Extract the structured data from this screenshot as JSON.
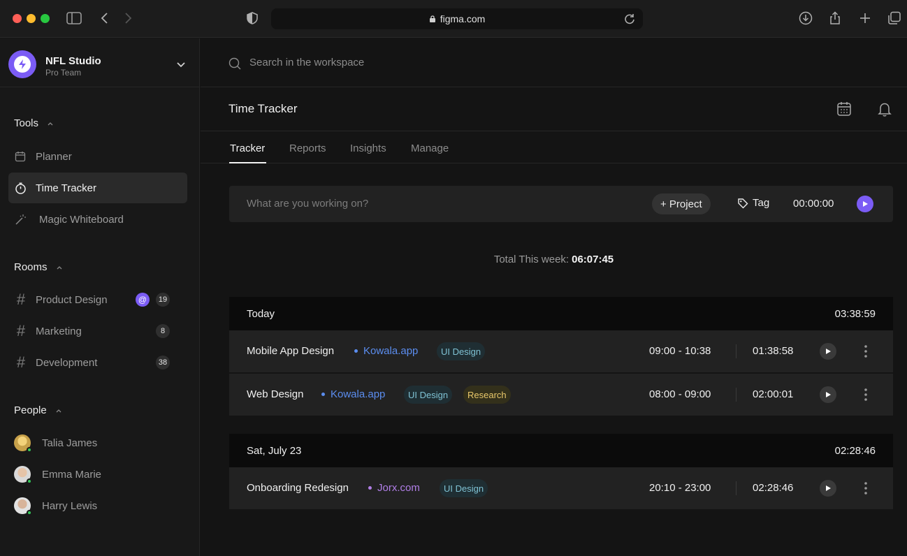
{
  "browser": {
    "url": "figma.com"
  },
  "workspace": {
    "name": "NFL Studio",
    "plan": "Pro Team"
  },
  "sidebar": {
    "tools_title": "Tools",
    "tools": [
      {
        "label": "Planner",
        "icon": "calendar-icon"
      },
      {
        "label": "Time Tracker",
        "icon": "stopwatch-icon",
        "active": true
      },
      {
        "label": "Magic Whiteboard",
        "icon": "magic-wand-icon"
      }
    ],
    "rooms_title": "Rooms",
    "rooms": [
      {
        "label": "Product Design",
        "mention": "@",
        "count": "19"
      },
      {
        "label": "Marketing",
        "count": "8"
      },
      {
        "label": "Development",
        "count": "38"
      }
    ],
    "people_title": "People",
    "people": [
      {
        "name": "Talia James"
      },
      {
        "name": "Emma Marie"
      },
      {
        "name": "Harry Lewis"
      }
    ]
  },
  "search": {
    "placeholder": "Search in the workspace"
  },
  "header": {
    "title": "Time Tracker"
  },
  "tabs": [
    {
      "label": "Tracker",
      "active": true
    },
    {
      "label": "Reports"
    },
    {
      "label": "Insights"
    },
    {
      "label": "Manage"
    }
  ],
  "tracker": {
    "placeholder": "What are you working on?",
    "project_label": "+ Project",
    "tag_label": "Tag",
    "timer": "00:00:00"
  },
  "total": {
    "label": "Total This week:",
    "value": "06:07:45"
  },
  "groups": [
    {
      "title": "Today",
      "total": "03:38:59",
      "entries": [
        {
          "name": "Mobile App Design",
          "project": "Kowala.app",
          "project_color": "#5b8def",
          "tags": [
            "UI Design"
          ],
          "range": "09:00  - 10:38",
          "duration": "01:38:58"
        },
        {
          "name": "Web Design",
          "project": "Kowala.app",
          "project_color": "#5b8def",
          "tags": [
            "UI Design",
            "Research"
          ],
          "range": "08:00  - 09:00",
          "duration": "02:00:01"
        }
      ]
    },
    {
      "title": "Sat, July 23",
      "total": "02:28:46",
      "entries": [
        {
          "name": "Onboarding Redesign",
          "project": "Jorx.com",
          "project_color": "#b07ee6",
          "tags": [
            "UI Design"
          ],
          "range": "20:10  - 23:00",
          "duration": "02:28:46"
        }
      ]
    }
  ],
  "colors": {
    "accent": "#7b5cf5",
    "online": "#35c759"
  }
}
